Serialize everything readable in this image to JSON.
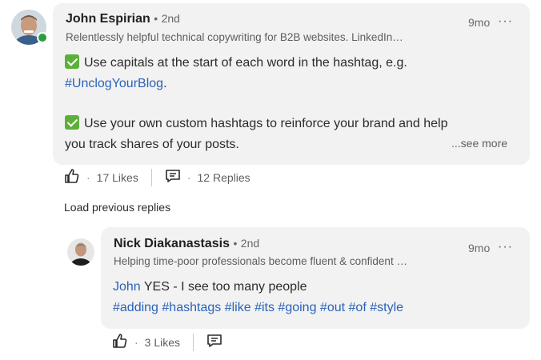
{
  "comment": {
    "author": "John Espirian",
    "degree_sep": "•",
    "degree": "2nd",
    "headline": "Relentlessly helpful technical copywriting for B2B websites. LinkedIn…",
    "time": "9mo",
    "menu": "···",
    "line1": "Use capitals at the start of each word in the hashtag, e.g.",
    "hashtag1": "#UnclogYourBlog",
    "period": ".",
    "line2a": "Use your own custom hashtags to reinforce your brand and help",
    "line2b": "you track shares of your posts.",
    "see_more": "...see more",
    "like_icon": "thumbs-up-icon",
    "reply_icon": "comment-icon",
    "dot": "·",
    "likes": "17 Likes",
    "replies": "12 Replies"
  },
  "load_previous": "Load previous replies",
  "reply": {
    "author": "Nick Diakanastasis",
    "degree_sep": "•",
    "degree": "2nd",
    "headline": "Helping time-poor professionals become fluent & confident …",
    "time": "9mo",
    "menu": "···",
    "mention": "John",
    "text": " YES - I see too many people",
    "hashtags": [
      "#adding",
      "#hashtags",
      "#like",
      "#its",
      "#going",
      "#out",
      "#of",
      "#style"
    ],
    "dot": "·",
    "likes": "3 Likes"
  },
  "colors": {
    "link": "#2a63b8",
    "bubble": "#f2f2f2",
    "check": "#5cb03a",
    "presence": "#2e9b3d"
  }
}
